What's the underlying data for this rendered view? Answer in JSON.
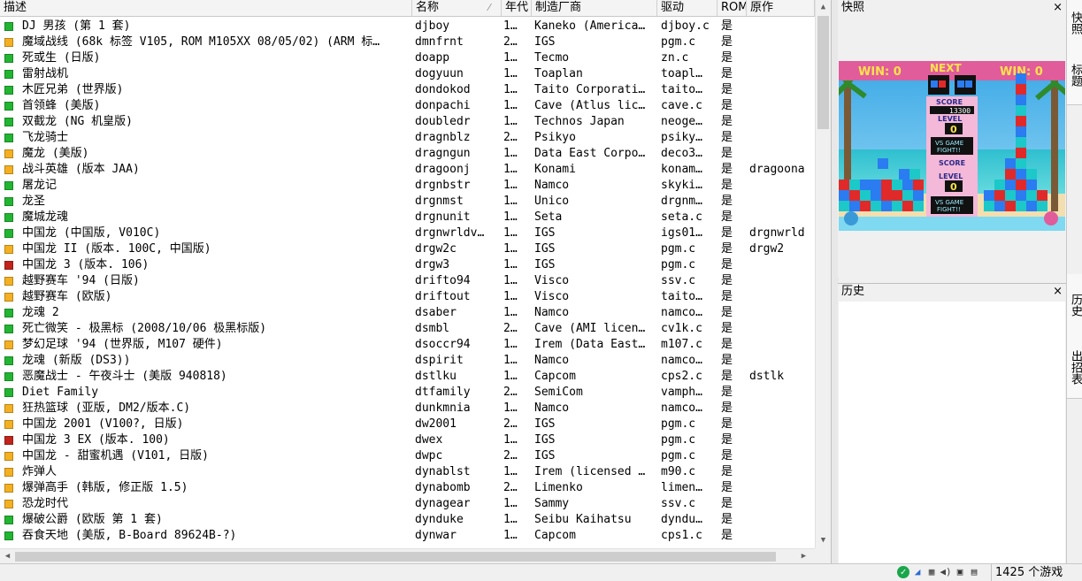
{
  "columns": {
    "desc": "描述",
    "name": "名称",
    "year": "年代",
    "maker": "制造厂商",
    "driver": "驱动",
    "rom": "ROM",
    "clone": "原作"
  },
  "status_colors": {
    "green": "#21b531",
    "yellow": "#f5b021",
    "red": "#c1241b"
  },
  "games": [
    {
      "status": "green",
      "desc": "DJ 男孩 (第 1 套)",
      "name": "djboy",
      "year": "1…",
      "maker": "Kaneko (America…",
      "driver": "djboy.c",
      "rom": "是",
      "clone": ""
    },
    {
      "status": "yellow",
      "desc": "魔域战线 (68k 标签 V105, ROM M105XX 08/05/02) (ARM 标…",
      "name": "dmnfrnt",
      "year": "2…",
      "maker": "IGS",
      "driver": "pgm.c",
      "rom": "是",
      "clone": ""
    },
    {
      "status": "green",
      "desc": "死或生 (日版)",
      "name": "doapp",
      "year": "1…",
      "maker": "Tecmo",
      "driver": "zn.c",
      "rom": "是",
      "clone": ""
    },
    {
      "status": "green",
      "desc": "雷射战机",
      "name": "dogyuun",
      "year": "1…",
      "maker": "Toaplan",
      "driver": "toapl…",
      "rom": "是",
      "clone": ""
    },
    {
      "status": "green",
      "desc": "木匠兄弟 (世界版)",
      "name": "dondokod",
      "year": "1…",
      "maker": "Taito Corporati…",
      "driver": "taito…",
      "rom": "是",
      "clone": ""
    },
    {
      "status": "green",
      "desc": "首领蜂 (美版)",
      "name": "donpachi",
      "year": "1…",
      "maker": "Cave (Atlus lic…",
      "driver": "cave.c",
      "rom": "是",
      "clone": ""
    },
    {
      "status": "green",
      "desc": "双截龙 (NG 机皇版)",
      "name": "doubledr",
      "year": "1…",
      "maker": "Technos Japan",
      "driver": "neoge…",
      "rom": "是",
      "clone": ""
    },
    {
      "status": "green",
      "desc": "飞龙骑士",
      "name": "dragnblz",
      "year": "2…",
      "maker": "Psikyo",
      "driver": "psiky…",
      "rom": "是",
      "clone": ""
    },
    {
      "status": "yellow",
      "desc": "魔龙 (美版)",
      "name": "dragngun",
      "year": "1…",
      "maker": "Data East Corpo…",
      "driver": "deco3…",
      "rom": "是",
      "clone": ""
    },
    {
      "status": "yellow",
      "desc": "战斗英雄 (版本 JAA)",
      "name": "dragoonj",
      "year": "1…",
      "maker": "Konami",
      "driver": "konam…",
      "rom": "是",
      "clone": "dragoona"
    },
    {
      "status": "green",
      "desc": "屠龙记",
      "name": "drgnbstr",
      "year": "1…",
      "maker": "Namco",
      "driver": "skyki…",
      "rom": "是",
      "clone": ""
    },
    {
      "status": "green",
      "desc": "龙圣",
      "name": "drgnmst",
      "year": "1…",
      "maker": "Unico",
      "driver": "drgnm…",
      "rom": "是",
      "clone": ""
    },
    {
      "status": "green",
      "desc": "魔城龙魂",
      "name": "drgnunit",
      "year": "1…",
      "maker": "Seta",
      "driver": "seta.c",
      "rom": "是",
      "clone": ""
    },
    {
      "status": "green",
      "desc": "中国龙 (中国版, V010C)",
      "name": "drgnwrldv…",
      "year": "1…",
      "maker": "IGS",
      "driver": "igs01…",
      "rom": "是",
      "clone": "drgnwrld"
    },
    {
      "status": "yellow",
      "desc": "中国龙 II (版本. 100C, 中国版)",
      "name": "drgw2c",
      "year": "1…",
      "maker": "IGS",
      "driver": "pgm.c",
      "rom": "是",
      "clone": "drgw2"
    },
    {
      "status": "red",
      "desc": "中国龙 3 (版本. 106)",
      "name": "drgw3",
      "year": "1…",
      "maker": "IGS",
      "driver": "pgm.c",
      "rom": "是",
      "clone": ""
    },
    {
      "status": "yellow",
      "desc": "越野赛车 '94 (日版)",
      "name": "drifto94",
      "year": "1…",
      "maker": "Visco",
      "driver": "ssv.c",
      "rom": "是",
      "clone": ""
    },
    {
      "status": "yellow",
      "desc": "越野赛车 (欧版)",
      "name": "driftout",
      "year": "1…",
      "maker": "Visco",
      "driver": "taito…",
      "rom": "是",
      "clone": ""
    },
    {
      "status": "green",
      "desc": "龙魂 2",
      "name": "dsaber",
      "year": "1…",
      "maker": "Namco",
      "driver": "namco…",
      "rom": "是",
      "clone": ""
    },
    {
      "status": "green",
      "desc": "死亡微笑 - 极黑标 (2008/10/06 极黑标版)",
      "name": "dsmbl",
      "year": "2…",
      "maker": "Cave (AMI licen…",
      "driver": "cv1k.c",
      "rom": "是",
      "clone": ""
    },
    {
      "status": "yellow",
      "desc": "梦幻足球 '94 (世界版, M107 硬件)",
      "name": "dsoccr94",
      "year": "1…",
      "maker": "Irem (Data East…",
      "driver": "m107.c",
      "rom": "是",
      "clone": ""
    },
    {
      "status": "green",
      "desc": "龙魂 (新版 (DS3))",
      "name": "dspirit",
      "year": "1…",
      "maker": "Namco",
      "driver": "namco…",
      "rom": "是",
      "clone": ""
    },
    {
      "status": "green",
      "desc": "恶魔战士 - 午夜斗士 (美版 940818)",
      "name": "dstlku",
      "year": "1…",
      "maker": "Capcom",
      "driver": "cps2.c",
      "rom": "是",
      "clone": "dstlk"
    },
    {
      "status": "green",
      "desc": "Diet Family",
      "name": "dtfamily",
      "year": "2…",
      "maker": "SemiCom",
      "driver": "vamph…",
      "rom": "是",
      "clone": ""
    },
    {
      "status": "yellow",
      "desc": "狂热篮球 (亚版, DM2/版本.C)",
      "name": "dunkmnia",
      "year": "1…",
      "maker": "Namco",
      "driver": "namco…",
      "rom": "是",
      "clone": ""
    },
    {
      "status": "yellow",
      "desc": "中国龙 2001 (V100?, 日版)",
      "name": "dw2001",
      "year": "2…",
      "maker": "IGS",
      "driver": "pgm.c",
      "rom": "是",
      "clone": ""
    },
    {
      "status": "red",
      "desc": "中国龙 3 EX (版本. 100)",
      "name": "dwex",
      "year": "1…",
      "maker": "IGS",
      "driver": "pgm.c",
      "rom": "是",
      "clone": ""
    },
    {
      "status": "yellow",
      "desc": "中国龙 - 甜蜜机遇 (V101, 日版)",
      "name": "dwpc",
      "year": "2…",
      "maker": "IGS",
      "driver": "pgm.c",
      "rom": "是",
      "clone": ""
    },
    {
      "status": "yellow",
      "desc": "炸弹人",
      "name": "dynablst",
      "year": "1…",
      "maker": "Irem (licensed …",
      "driver": "m90.c",
      "rom": "是",
      "clone": ""
    },
    {
      "status": "yellow",
      "desc": "爆弹高手 (韩版, 修正版 1.5)",
      "name": "dynabomb",
      "year": "2…",
      "maker": "Limenko",
      "driver": "limen…",
      "rom": "是",
      "clone": ""
    },
    {
      "status": "yellow",
      "desc": "恐龙时代",
      "name": "dynagear",
      "year": "1…",
      "maker": "Sammy",
      "driver": "ssv.c",
      "rom": "是",
      "clone": ""
    },
    {
      "status": "green",
      "desc": "爆破公爵 (欧版 第 1 套)",
      "name": "dynduke",
      "year": "1…",
      "maker": "Seibu Kaihatsu",
      "driver": "dyndu…",
      "rom": "是",
      "clone": ""
    },
    {
      "status": "green",
      "desc": "吞食天地 (美版, B-Board 89624B-?)",
      "name": "dynwar",
      "year": "1…",
      "maker": "Capcom",
      "driver": "cps1.c",
      "rom": "是",
      "clone": ""
    }
  ],
  "panels": {
    "snapshot": {
      "title": "快照",
      "close": "×"
    },
    "history": {
      "title": "历史",
      "close": "×"
    }
  },
  "snapshot_game": {
    "win_left": "WIN: 0",
    "next": "NEXT",
    "win_right": "WIN: 0",
    "score_label": "SCORE",
    "score_value": "13300",
    "level_label": "LEVEL",
    "level_top": "0",
    "vs_text_1": "VS GAME",
    "vs_text_2": "FIGHT!!",
    "score_label_2": "SCORE",
    "level_label_2": "LEVEL",
    "level_bottom": "0",
    "vs_text_3": "VS GAME",
    "vs_text_4": "FIGHT!!"
  },
  "side_tabs": [
    "快照",
    "标题",
    "历史",
    "出招表"
  ],
  "statusbar": {
    "count": "1425 个游戏"
  },
  "icons": {
    "status_ok": "check-circle-icon",
    "graphics": "graphics-icon",
    "palette": "palette-icon",
    "sound": "speaker-icon",
    "input": "joystick-icon",
    "save": "floppy-icon"
  }
}
